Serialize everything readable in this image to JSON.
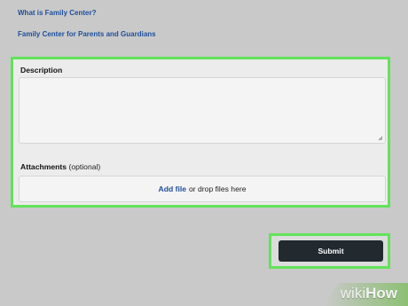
{
  "top_links": {
    "family_center": "What is Family Center?",
    "parents_guardians": "Family Center for Parents and Guardians"
  },
  "form": {
    "description_label": "Description",
    "description_value": "",
    "attachments_label": "Attachments",
    "attachments_optional": "(optional)",
    "add_file_label": "Add file",
    "drop_files_text": "or drop files here"
  },
  "actions": {
    "submit_label": "Submit"
  },
  "watermark": {
    "wiki": "wiki",
    "how": "How"
  },
  "colors": {
    "highlight": "#62e35a",
    "link": "#1f4f9a",
    "submit_background": "#222a30",
    "page_background": "#c9c9c9"
  },
  "icons": {
    "resize_handle": "resize-handle-icon"
  }
}
